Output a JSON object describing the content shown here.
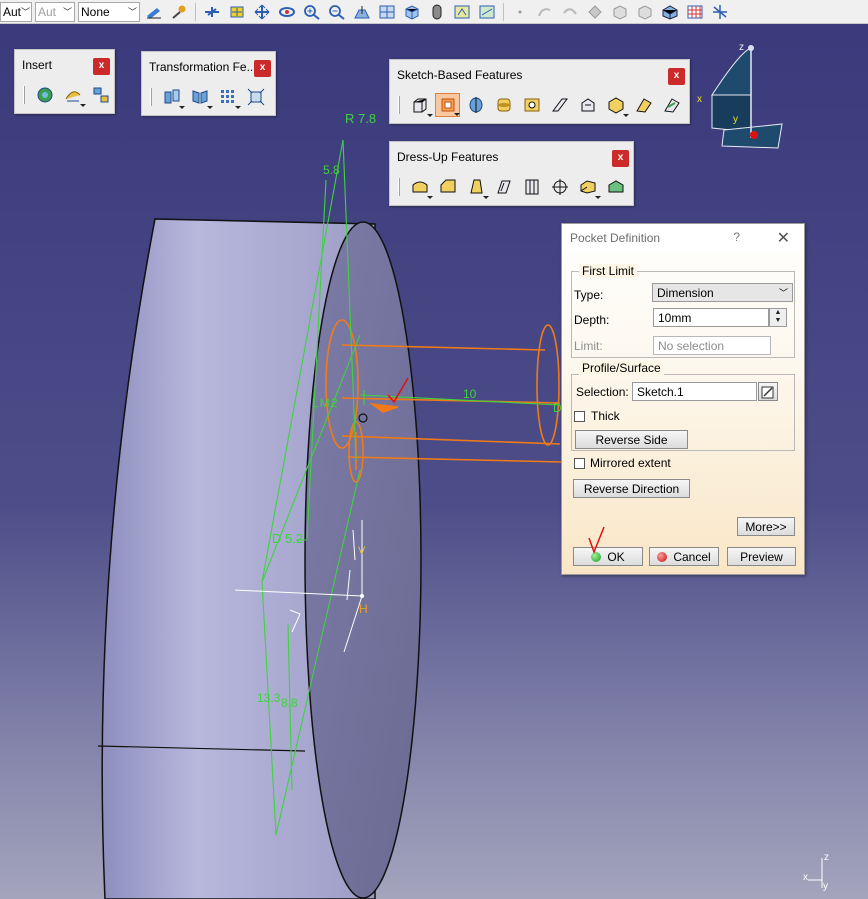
{
  "toolbar": {
    "combo1": "Aut",
    "combo2": "Aut",
    "combo3": "None"
  },
  "panels": {
    "insert": {
      "title": "Insert"
    },
    "transformation": {
      "title": "Transformation Fe..."
    },
    "sketch_based": {
      "title": "Sketch-Based Features"
    },
    "dress_up": {
      "title": "Dress-Up Features"
    }
  },
  "close_glyph": "x",
  "dimensions": {
    "r": "R 7.8",
    "d1": "5.8",
    "lm": "L M 2",
    "d10": "10",
    "d52": "D 5.2",
    "d133": "13.3",
    "d88": "8.8",
    "h": "H",
    "v": "V",
    "d_end": "D"
  },
  "compass": {
    "z": "z",
    "y": "y",
    "x": "x"
  },
  "axes": {
    "z": "z",
    "x": "x",
    "y": "y"
  },
  "dialog": {
    "title": "Pocket Definition",
    "help": "?",
    "close": "✕",
    "first_limit": "First Limit",
    "type_label": "Type:",
    "type_value": "Dimension",
    "depth_label": "Depth:",
    "depth_value": "10mm",
    "limit_label": "Limit:",
    "limit_value": "No selection",
    "profile_surface": "Profile/Surface",
    "selection_label": "Selection:",
    "selection_value": "Sketch.1",
    "thick_label": "Thick",
    "reverse_side": "Reverse Side",
    "mirrored_label": "Mirrored extent",
    "reverse_direction": "Reverse Direction",
    "more": "More>>",
    "ok": "OK",
    "cancel": "Cancel",
    "preview": "Preview"
  },
  "colors": {
    "background_top": "#3a3a7c",
    "annotation_green": "#3fd23f",
    "profile_orange": "#f07a1a",
    "check_red": "#e01010"
  }
}
